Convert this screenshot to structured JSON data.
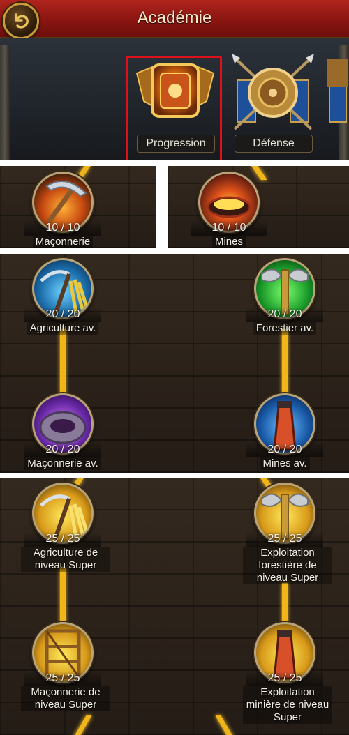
{
  "header": {
    "title": "Académie"
  },
  "categories": [
    {
      "label": "Progression",
      "selected": true
    },
    {
      "label": "Défense",
      "selected": false
    }
  ],
  "colors": {
    "accent": "#f1b51a",
    "selection": "#e0101a",
    "header": "#8f1712"
  },
  "tree": {
    "row1": [
      {
        "count": "10 / 10",
        "name": "Maçonnerie",
        "icon": "pickaxe-icon"
      },
      {
        "count": "10 / 10",
        "name": "Mines",
        "icon": "furnace-icon"
      }
    ],
    "row2": [
      {
        "count": "20 / 20",
        "name": "Agriculture av.",
        "icon": "scythe-wheat-icon"
      },
      {
        "count": "20 / 20",
        "name": "Forestier av.",
        "icon": "axe-icon"
      },
      {
        "count": "20 / 20",
        "name": "Maçonnerie av.",
        "icon": "stone-ring-icon"
      },
      {
        "count": "20 / 20",
        "name": "Mines av.",
        "icon": "mine-tower-icon"
      }
    ],
    "row3": [
      {
        "count": "25 / 25",
        "name_lines": [
          "Agriculture de",
          "niveau Super"
        ],
        "icon": "scythe-wheat-icon"
      },
      {
        "count": "25 / 25",
        "name_lines": [
          "Exploitation",
          "forestière de",
          "niveau Super"
        ],
        "icon": "axe-icon"
      },
      {
        "count": "25 / 25",
        "name_lines": [
          "Maçonnerie de",
          "niveau Super"
        ],
        "icon": "scaffold-icon"
      },
      {
        "count": "25 / 25",
        "name_lines": [
          "Exploitation",
          "minière de niveau",
          "Super"
        ],
        "icon": "mine-tower-icon"
      }
    ]
  }
}
